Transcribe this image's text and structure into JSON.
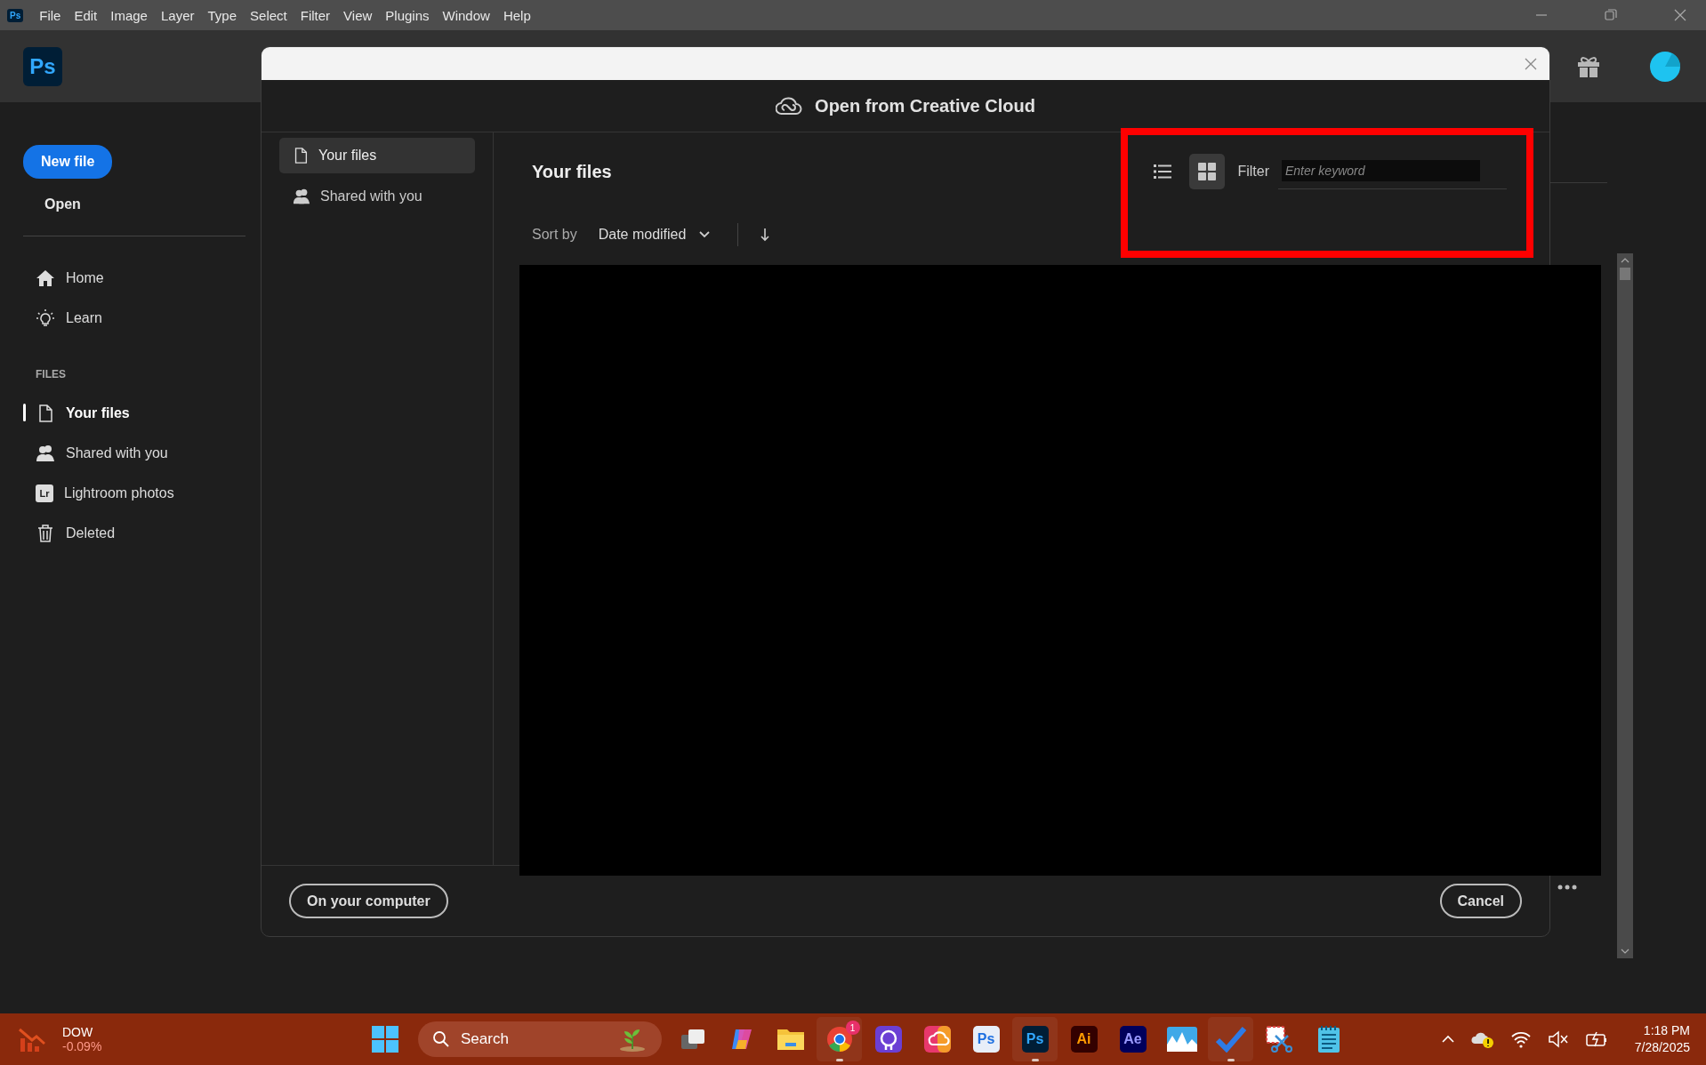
{
  "menu_bar": {
    "app_badge": "Ps",
    "items": [
      "File",
      "Edit",
      "Image",
      "Layer",
      "Type",
      "Select",
      "Filter",
      "View",
      "Plugins",
      "Window",
      "Help"
    ]
  },
  "app_header": {
    "logo": "Ps"
  },
  "sidebar": {
    "new_file": "New file",
    "open": "Open",
    "nav": [
      {
        "label": "Home"
      },
      {
        "label": "Learn"
      }
    ],
    "files_heading": "FILES",
    "files": [
      {
        "label": "Your files",
        "selected": true
      },
      {
        "label": "Shared with you",
        "selected": false
      },
      {
        "label": "Lightroom photos",
        "badge": "Lr",
        "selected": false
      },
      {
        "label": "Deleted",
        "selected": false
      }
    ]
  },
  "dialog": {
    "title": "Open from Creative Cloud",
    "nav": [
      {
        "label": "Your files",
        "selected": true
      },
      {
        "label": "Shared with you",
        "selected": false
      }
    ],
    "heading": "Your files",
    "sort_label": "Sort by",
    "sort_value": "Date modified",
    "views": [
      {
        "kind": "list",
        "selected": false
      },
      {
        "kind": "grid",
        "selected": true
      }
    ],
    "filter_label": "Filter",
    "filter": {
      "placeholder": "Enter keyword"
    },
    "left_button": "On your computer",
    "cancel_button": "Cancel"
  },
  "taskbar": {
    "ticker": {
      "name": "DOW",
      "change": "-0.09%"
    },
    "search_label": "Search",
    "apps": [
      {
        "kind": "taskview",
        "running": false
      },
      {
        "kind": "copilot",
        "running": false
      },
      {
        "kind": "explorer",
        "running": false
      },
      {
        "kind": "chrome",
        "badge": "1",
        "running": true
      },
      {
        "kind": "ring",
        "running": false
      },
      {
        "kind": "cc",
        "running": false
      },
      {
        "kind": "ps-light",
        "label": "Ps",
        "running": false
      },
      {
        "kind": "ps",
        "label": "Ps",
        "running": true
      },
      {
        "kind": "ai",
        "label": "Ai",
        "running": false
      },
      {
        "kind": "ae",
        "label": "Ae",
        "running": false
      },
      {
        "kind": "wave",
        "running": false
      },
      {
        "kind": "check",
        "running": true
      },
      {
        "kind": "snip",
        "running": false
      },
      {
        "kind": "notepad",
        "running": false
      }
    ],
    "clock": {
      "time": "1:18 PM",
      "date": "7/28/2025"
    }
  }
}
